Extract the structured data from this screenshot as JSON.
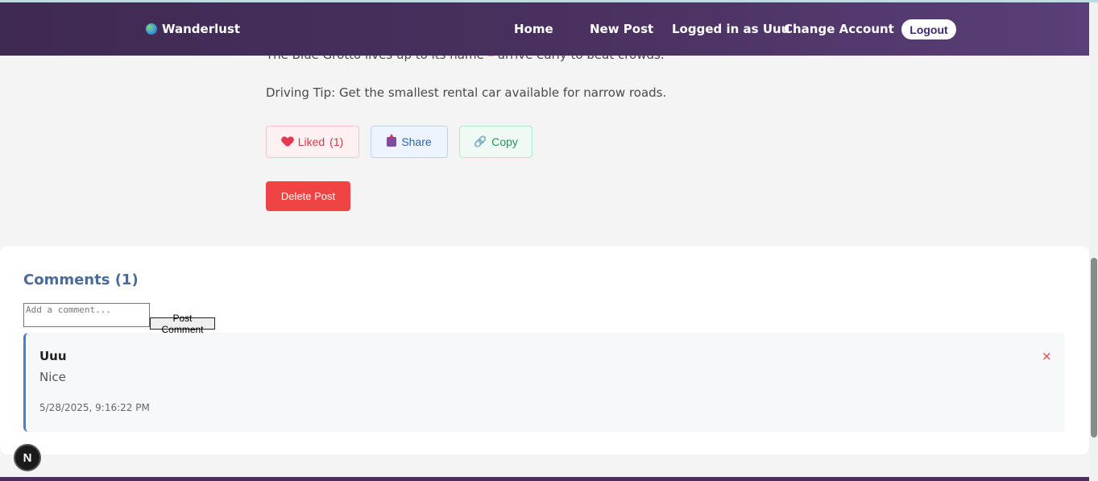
{
  "navbar": {
    "brand": "Wanderlust",
    "home": "Home",
    "new_post": "New Post",
    "logged_in_prefix": "Logged in as",
    "username": "Uuu",
    "change_account": "Change Account",
    "logout": "Logout"
  },
  "post": {
    "cut_text_before": "The Blue Grotto lives up to its name",
    "cut_text_dash": " – ",
    "cut_text_after": "arrive early to beat crowds.",
    "driving_tip": "Driving Tip: Get the smallest rental car available for narrow roads."
  },
  "actions": {
    "liked_label": "Liked",
    "liked_count": "(1)",
    "share_label": "Share",
    "copy_label": "Copy",
    "delete_post": "Delete Post"
  },
  "comments": {
    "title": "Comments (1)",
    "input_placeholder": "Add a comment...",
    "post_button": "Post Comment",
    "items": [
      {
        "author": "Uuu",
        "text": "Nice",
        "timestamp": "5/28/2025, 9:16:22 PM",
        "delete_symbol": "×"
      }
    ]
  },
  "dev_badge": "N",
  "colors": {
    "navbar": "#4a3160",
    "delete": "#ef4444",
    "comment_accent": "#4a7bd0",
    "comments_title": "#4a6b9a"
  }
}
